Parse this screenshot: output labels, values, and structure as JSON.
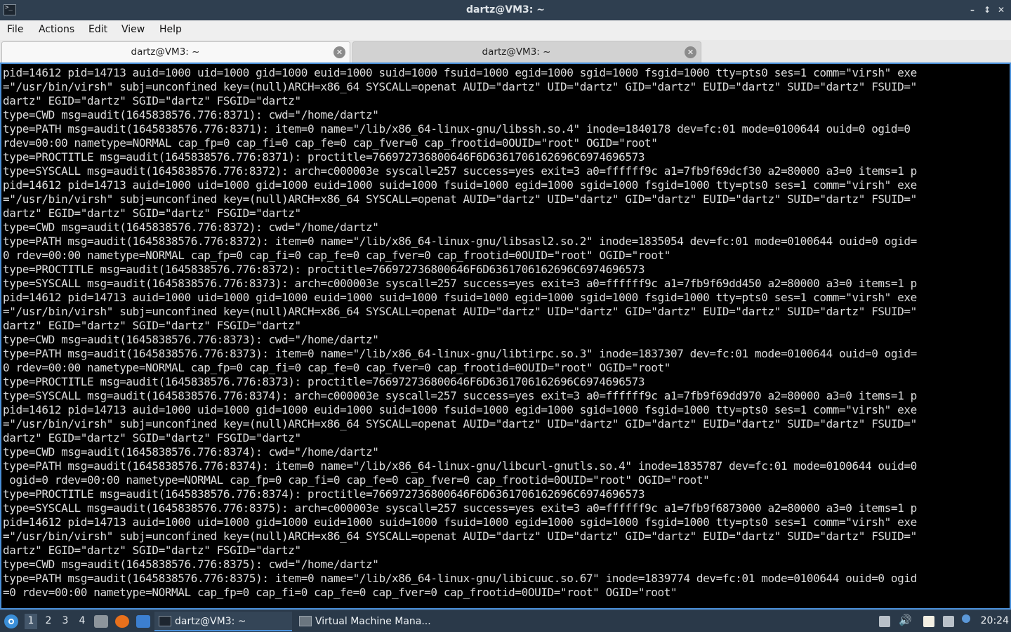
{
  "window": {
    "title": "dartz@VM3: ~",
    "minimize_glyph": "–",
    "restore_glyph": "↕",
    "close_glyph": "✕"
  },
  "menu": [
    "File",
    "Actions",
    "Edit",
    "View",
    "Help"
  ],
  "tabs": [
    {
      "label": "dartz@VM3: ~",
      "active": true
    },
    {
      "label": "dartz@VM3: ~",
      "active": false
    }
  ],
  "terminal_lines": [
    "pid=14612 pid=14713 auid=1000 uid=1000 gid=1000 euid=1000 suid=1000 fsuid=1000 egid=1000 sgid=1000 fsgid=1000 tty=pts0 ses=1 comm=\"virsh\" exe",
    "=\"/usr/bin/virsh\" subj=unconfined key=(null)ARCH=x86_64 SYSCALL=openat AUID=\"dartz\" UID=\"dartz\" GID=\"dartz\" EUID=\"dartz\" SUID=\"dartz\" FSUID=\"",
    "dartz\" EGID=\"dartz\" SGID=\"dartz\" FSGID=\"dartz\"",
    "type=CWD msg=audit(1645838576.776:8371): cwd=\"/home/dartz\"",
    "type=PATH msg=audit(1645838576.776:8371): item=0 name=\"/lib/x86_64-linux-gnu/libssh.so.4\" inode=1840178 dev=fc:01 mode=0100644 ouid=0 ogid=0",
    "rdev=00:00 nametype=NORMAL cap_fp=0 cap_fi=0 cap_fe=0 cap_fver=0 cap_frootid=0OUID=\"root\" OGID=\"root\"",
    "type=PROCTITLE msg=audit(1645838576.776:8371): proctitle=766972736800646F6D6361706162696C6974696573",
    "type=SYSCALL msg=audit(1645838576.776:8372): arch=c000003e syscall=257 success=yes exit=3 a0=ffffff9c a1=7fb9f69dcf30 a2=80000 a3=0 items=1 p",
    "pid=14612 pid=14713 auid=1000 uid=1000 gid=1000 euid=1000 suid=1000 fsuid=1000 egid=1000 sgid=1000 fsgid=1000 tty=pts0 ses=1 comm=\"virsh\" exe",
    "=\"/usr/bin/virsh\" subj=unconfined key=(null)ARCH=x86_64 SYSCALL=openat AUID=\"dartz\" UID=\"dartz\" GID=\"dartz\" EUID=\"dartz\" SUID=\"dartz\" FSUID=\"",
    "dartz\" EGID=\"dartz\" SGID=\"dartz\" FSGID=\"dartz\"",
    "type=CWD msg=audit(1645838576.776:8372): cwd=\"/home/dartz\"",
    "type=PATH msg=audit(1645838576.776:8372): item=0 name=\"/lib/x86_64-linux-gnu/libsasl2.so.2\" inode=1835054 dev=fc:01 mode=0100644 ouid=0 ogid=",
    "0 rdev=00:00 nametype=NORMAL cap_fp=0 cap_fi=0 cap_fe=0 cap_fver=0 cap_frootid=0OUID=\"root\" OGID=\"root\"",
    "type=PROCTITLE msg=audit(1645838576.776:8372): proctitle=766972736800646F6D6361706162696C6974696573",
    "type=SYSCALL msg=audit(1645838576.776:8373): arch=c000003e syscall=257 success=yes exit=3 a0=ffffff9c a1=7fb9f69dd450 a2=80000 a3=0 items=1 p",
    "pid=14612 pid=14713 auid=1000 uid=1000 gid=1000 euid=1000 suid=1000 fsuid=1000 egid=1000 sgid=1000 fsgid=1000 tty=pts0 ses=1 comm=\"virsh\" exe",
    "=\"/usr/bin/virsh\" subj=unconfined key=(null)ARCH=x86_64 SYSCALL=openat AUID=\"dartz\" UID=\"dartz\" GID=\"dartz\" EUID=\"dartz\" SUID=\"dartz\" FSUID=\"",
    "dartz\" EGID=\"dartz\" SGID=\"dartz\" FSGID=\"dartz\"",
    "type=CWD msg=audit(1645838576.776:8373): cwd=\"/home/dartz\"",
    "type=PATH msg=audit(1645838576.776:8373): item=0 name=\"/lib/x86_64-linux-gnu/libtirpc.so.3\" inode=1837307 dev=fc:01 mode=0100644 ouid=0 ogid=",
    "0 rdev=00:00 nametype=NORMAL cap_fp=0 cap_fi=0 cap_fe=0 cap_fver=0 cap_frootid=0OUID=\"root\" OGID=\"root\"",
    "type=PROCTITLE msg=audit(1645838576.776:8373): proctitle=766972736800646F6D6361706162696C6974696573",
    "type=SYSCALL msg=audit(1645838576.776:8374): arch=c000003e syscall=257 success=yes exit=3 a0=ffffff9c a1=7fb9f69dd970 a2=80000 a3=0 items=1 p",
    "pid=14612 pid=14713 auid=1000 uid=1000 gid=1000 euid=1000 suid=1000 fsuid=1000 egid=1000 sgid=1000 fsgid=1000 tty=pts0 ses=1 comm=\"virsh\" exe",
    "=\"/usr/bin/virsh\" subj=unconfined key=(null)ARCH=x86_64 SYSCALL=openat AUID=\"dartz\" UID=\"dartz\" GID=\"dartz\" EUID=\"dartz\" SUID=\"dartz\" FSUID=\"",
    "dartz\" EGID=\"dartz\" SGID=\"dartz\" FSGID=\"dartz\"",
    "type=CWD msg=audit(1645838576.776:8374): cwd=\"/home/dartz\"",
    "type=PATH msg=audit(1645838576.776:8374): item=0 name=\"/lib/x86_64-linux-gnu/libcurl-gnutls.so.4\" inode=1835787 dev=fc:01 mode=0100644 ouid=0",
    " ogid=0 rdev=00:00 nametype=NORMAL cap_fp=0 cap_fi=0 cap_fe=0 cap_fver=0 cap_frootid=0OUID=\"root\" OGID=\"root\"",
    "type=PROCTITLE msg=audit(1645838576.776:8374): proctitle=766972736800646F6D6361706162696C6974696573",
    "type=SYSCALL msg=audit(1645838576.776:8375): arch=c000003e syscall=257 success=yes exit=3 a0=ffffff9c a1=7fb9f6873000 a2=80000 a3=0 items=1 p",
    "pid=14612 pid=14713 auid=1000 uid=1000 gid=1000 euid=1000 suid=1000 fsuid=1000 egid=1000 sgid=1000 fsgid=1000 tty=pts0 ses=1 comm=\"virsh\" exe",
    "=\"/usr/bin/virsh\" subj=unconfined key=(null)ARCH=x86_64 SYSCALL=openat AUID=\"dartz\" UID=\"dartz\" GID=\"dartz\" EUID=\"dartz\" SUID=\"dartz\" FSUID=\"",
    "dartz\" EGID=\"dartz\" SGID=\"dartz\" FSGID=\"dartz\"",
    "type=CWD msg=audit(1645838576.776:8375): cwd=\"/home/dartz\"",
    "type=PATH msg=audit(1645838576.776:8375): item=0 name=\"/lib/x86_64-linux-gnu/libicuuc.so.67\" inode=1839774 dev=fc:01 mode=0100644 ouid=0 ogid",
    "=0 rdev=00:00 nametype=NORMAL cap_fp=0 cap_fi=0 cap_fe=0 cap_fver=0 cap_frootid=0OUID=\"root\" OGID=\"root\""
  ],
  "taskbar": {
    "workspaces": [
      "1",
      "2",
      "3",
      "4"
    ],
    "active_workspace": "1",
    "tasks": [
      {
        "label": "dartz@VM3: ~",
        "icon": "terminal-icon",
        "active": true
      },
      {
        "label": "Virtual Machine Mana...",
        "icon": "virt-manager-icon",
        "active": false
      }
    ],
    "volume_glyph": "🔊",
    "clock": "20:24"
  },
  "colors": {
    "accent": "#4a90d9",
    "terminal_bg": "#000000",
    "terminal_fg": "#dcdcdc",
    "titlebar_bg": "#2f3f50",
    "taskbar_bg": "#2a3949"
  }
}
